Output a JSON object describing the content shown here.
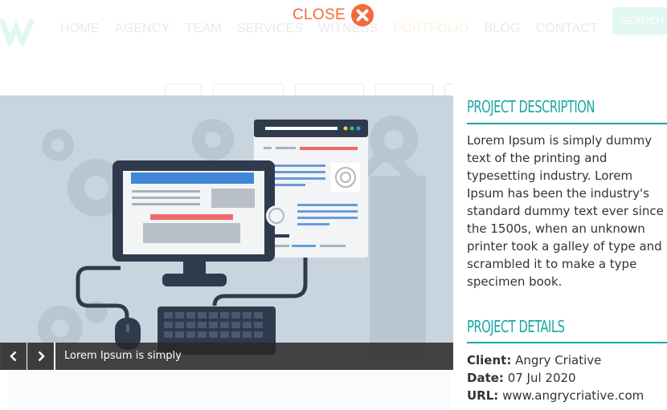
{
  "background": {
    "nav": [
      "HOME",
      "AGENCY",
      "TEAM",
      "SERVICES",
      "WITNESS",
      "PORTFOLIO",
      "BLOG",
      "CONTACT"
    ],
    "search_label": "SEARCH"
  },
  "close": {
    "label": "CLOSE",
    "icon": "close-icon",
    "color": "#f26b3a"
  },
  "slider": {
    "caption": "Lorem Ipsum is simply",
    "prev_icon": "chevron-left-icon",
    "next_icon": "chevron-right-icon"
  },
  "project": {
    "description_title": "PROJECT DESCRIPTION",
    "description": "Lorem Ipsum is simply dummy text of the printing and typesetting industry. Lorem Ipsum has been the industry's standard dummy text ever since the 1500s, when an unknown printer took a galley of type and scrambled it to make a type specimen book.",
    "details_title": "PROJECT DETAILS",
    "client_label": "Client:",
    "client": "Angry Criative",
    "date_label": "Date:",
    "date": "07 Jul 2020",
    "url_label": "URL:",
    "url": "www.angrycriative.com"
  },
  "colors": {
    "accent": "#19a7a3",
    "close": "#f26b3a",
    "slide_bg": "#c9d5de"
  }
}
